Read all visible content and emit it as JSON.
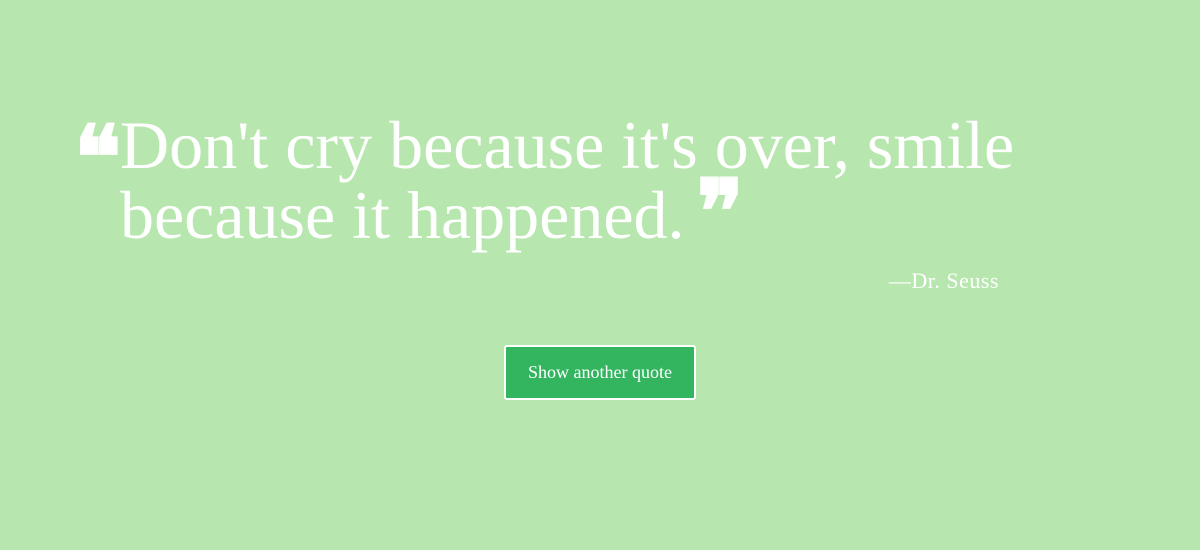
{
  "quote": {
    "open_mark": "❝",
    "text": "Don't cry because it's over, smile because it happened.",
    "close_mark": "❞",
    "author": "—Dr. Seuss"
  },
  "actions": {
    "new_quote_label": "Show another quote"
  },
  "colors": {
    "background": "#b7e7ae",
    "button": "#33b560",
    "text": "#ffffff"
  }
}
